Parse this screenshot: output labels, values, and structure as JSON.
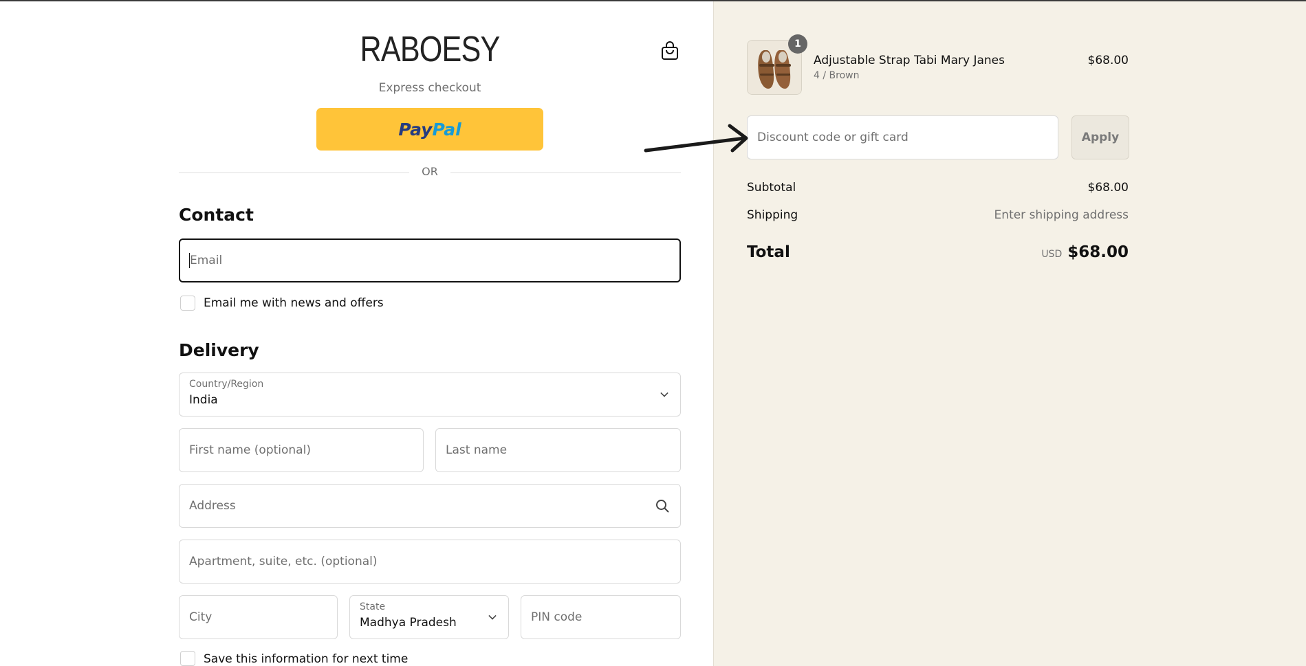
{
  "brand": {
    "name": "RABOESY"
  },
  "express": {
    "label": "Express checkout",
    "paypal_p1": "Pay",
    "paypal_p2": "Pal",
    "or": "OR"
  },
  "contact": {
    "heading": "Contact",
    "email_placeholder": "Email",
    "news_label": "Email me with news and offers"
  },
  "delivery": {
    "heading": "Delivery",
    "country_label": "Country/Region",
    "country_value": "India",
    "first_name_placeholder": "First name (optional)",
    "last_name_placeholder": "Last name",
    "address_placeholder": "Address",
    "apartment_placeholder": "Apartment, suite, etc. (optional)",
    "city_placeholder": "City",
    "state_label": "State",
    "state_value": "Madhya Pradesh",
    "pin_placeholder": "PIN code",
    "save_label": "Save this information for next time"
  },
  "summary": {
    "item": {
      "name": "Adjustable Strap Tabi Mary Janes",
      "variant": "4 / Brown",
      "price": "$68.00",
      "quantity": "1"
    },
    "discount_placeholder": "Discount code or gift card",
    "apply_label": "Apply",
    "subtotal_label": "Subtotal",
    "subtotal_value": "$68.00",
    "shipping_label": "Shipping",
    "shipping_value": "Enter shipping address",
    "total_label": "Total",
    "currency": "USD",
    "total_value": "$68.00"
  },
  "colors": {
    "paypal": "#ffc439",
    "right_bg": "#f5f1e7",
    "focus_border": "#111111"
  },
  "icons": {
    "cart": "bag-icon",
    "search": "search-icon",
    "chevron": "chevron-down-icon",
    "annotation": "arrow-icon"
  }
}
